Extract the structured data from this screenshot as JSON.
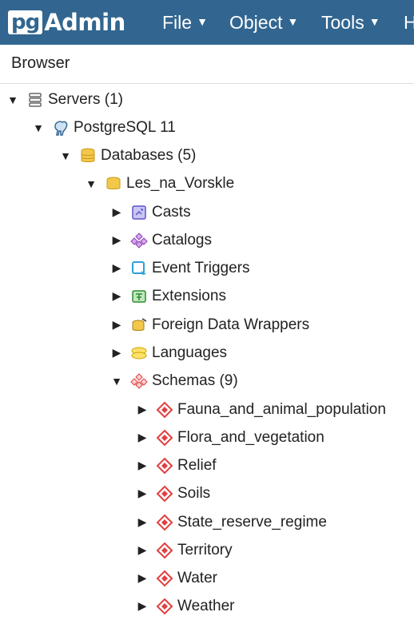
{
  "app": {
    "logo_pg": "pg",
    "logo_text": "Admin"
  },
  "menu": {
    "file": "File",
    "object": "Object",
    "tools": "Tools",
    "help": "H"
  },
  "browser": {
    "title": "Browser"
  },
  "tree": {
    "servers": "Servers (1)",
    "postgres": "PostgreSQL 11",
    "databases": "Databases (5)",
    "db": "Les_na_Vorskle",
    "casts": "Casts",
    "catalogs": "Catalogs",
    "event_triggers": "Event Triggers",
    "extensions": "Extensions",
    "fdw": "Foreign Data Wrappers",
    "languages": "Languages",
    "schemas": "Schemas (9)",
    "schema_items": [
      "Fauna_and_animal_population",
      "Flora_and_vegetation",
      "Relief",
      "Soils",
      "State_reserve_regime",
      "Territory",
      "Water",
      "Weather"
    ]
  },
  "colors": {
    "topbar": "#326690",
    "schema_icon": "#e04040",
    "db_icon": "#e0b030"
  }
}
